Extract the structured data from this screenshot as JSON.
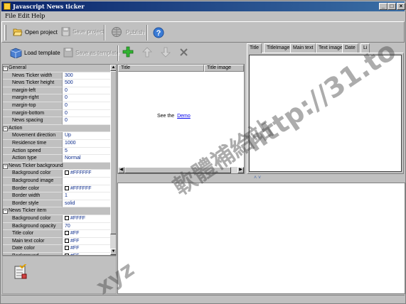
{
  "window": {
    "title": "Javascript News ticker",
    "controls": {
      "minimize": "_",
      "maximize": "□",
      "close": "×"
    }
  },
  "menu": {
    "items": [
      {
        "label": "File"
      },
      {
        "label": "Edit"
      },
      {
        "label": "Help"
      }
    ]
  },
  "toolbar": {
    "open_project": "Open project",
    "save_project": "Save project",
    "publish": "Publish",
    "help_icon": "help-icon"
  },
  "toolbar2": {
    "load_template": "Load template",
    "save_as_template": "Save as template",
    "add_icon": "plus-icon",
    "up_icon": "arrow-up-icon",
    "down_icon": "arrow-down-icon",
    "delete_icon": "x-icon"
  },
  "properties": [
    {
      "type": "category",
      "name": "General"
    },
    {
      "type": "prop",
      "name": "News Ticker width",
      "value": "300"
    },
    {
      "type": "prop",
      "name": "News Ticker height",
      "value": "500"
    },
    {
      "type": "prop",
      "name": "margin-left",
      "value": "0"
    },
    {
      "type": "prop",
      "name": "margin-right",
      "value": "0"
    },
    {
      "type": "prop",
      "name": "margin-top",
      "value": "0"
    },
    {
      "type": "prop",
      "name": "margin-bottom",
      "value": "0"
    },
    {
      "type": "prop",
      "name": "News spacing",
      "value": "0"
    },
    {
      "type": "category",
      "name": "Action"
    },
    {
      "type": "prop",
      "name": "Movement direction",
      "value": "Up"
    },
    {
      "type": "prop",
      "name": "Residence time",
      "value": "1000"
    },
    {
      "type": "prop",
      "name": "Action speed",
      "value": "5"
    },
    {
      "type": "prop",
      "name": "Action type",
      "value": "Normal"
    },
    {
      "type": "category",
      "name": "News Ticker background"
    },
    {
      "type": "prop",
      "name": "Background color",
      "value": "#FFFFFF",
      "swatch": true
    },
    {
      "type": "prop",
      "name": "Background image",
      "value": ""
    },
    {
      "type": "prop",
      "name": "Border color",
      "value": "#FFFFFF",
      "swatch": true
    },
    {
      "type": "prop",
      "name": "Border width",
      "value": "1"
    },
    {
      "type": "prop",
      "name": "Border style",
      "value": "solid"
    },
    {
      "type": "category",
      "name": "News Ticker item"
    },
    {
      "type": "prop",
      "name": "Background color",
      "value": "#FFFF",
      "swatch": true
    },
    {
      "type": "prop",
      "name": "Background opacity",
      "value": "70"
    },
    {
      "type": "prop",
      "name": "Title color",
      "value": "#FF",
      "swatch": true
    },
    {
      "type": "prop",
      "name": "Main text color",
      "value": "#FF",
      "swatch": true
    },
    {
      "type": "prop",
      "name": "Date color",
      "value": "#FF",
      "swatch": true
    },
    {
      "type": "prop",
      "name": "Background",
      "value": "#FF",
      "swatch": true
    }
  ],
  "list": {
    "columns": [
      "Title",
      "Title image"
    ],
    "see_the": "See the",
    "demo_link": "Demo"
  },
  "preview_tabs": [
    "Title",
    "TitleImage",
    "Main text",
    "Text image",
    "Date",
    "Li"
  ],
  "splitter_arrows": "˄ ˅",
  "watermarks": {
    "url": "http://31.to",
    "chinese": "軟體補給站",
    "prefix": "xyz"
  },
  "colors": {
    "titlebar_start": "#0a246a",
    "titlebar_end": "#3a6ea5",
    "value_text": "#0a2a8a",
    "link": "#0000ee"
  }
}
